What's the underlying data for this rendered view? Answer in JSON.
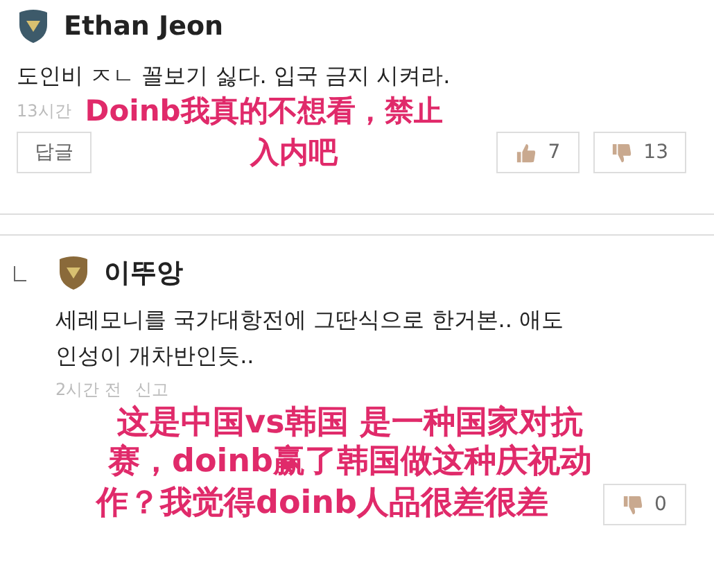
{
  "comments": [
    {
      "author": "Ethan Jeon",
      "reply": false,
      "lines": [
        "도인비 ㅈㄴ 꼴보기 싫다. 입국 금지 시켜라."
      ],
      "time": "13시간",
      "reply_button": "답글",
      "likes": "7",
      "dislikes": "13",
      "annotation": [
        "Doinb我真的不想看，禁止",
        "入内吧"
      ]
    },
    {
      "author": "이뚜앙",
      "reply": true,
      "lines": [
        "세레모니를 국가대항전에 그딴식으로 한거본.. 애도",
        "인성이 개차반인듯.."
      ],
      "time": "2시간 전",
      "report": "신고",
      "dislikes": "0",
      "annotation": [
        "这是中国vs韩国 是一种国家对抗",
        "赛，doinb赢了韩国做这种庆祝动",
        "作？我觉得doinb人品很差很差"
      ]
    }
  ]
}
